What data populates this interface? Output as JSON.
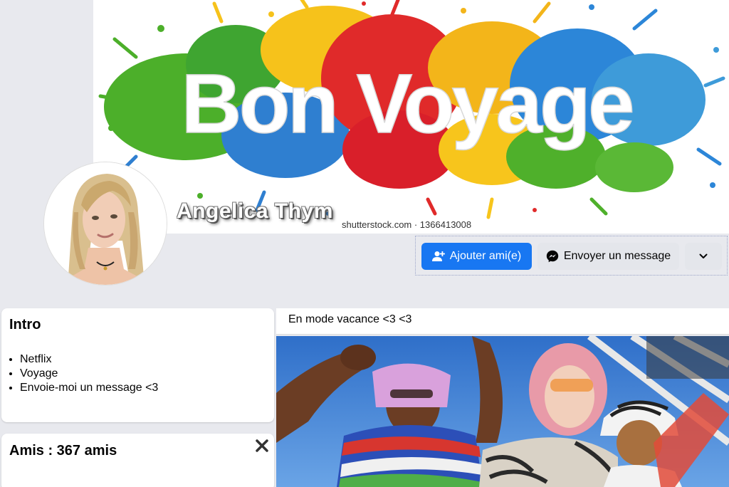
{
  "profile": {
    "name": "Angelica Thym",
    "cover_title": "Bon Voyage",
    "cover_watermark": "shutterstock.com · 1366413008"
  },
  "actions": {
    "add_friend_label": "Ajouter ami(e)",
    "message_label": "Envoyer un message"
  },
  "intro": {
    "title": "Intro",
    "items": [
      "Netflix",
      "Voyage",
      "Envoie-moi un message <3"
    ]
  },
  "friends": {
    "title": "Amis : 367 amis"
  },
  "post": {
    "text": "En mode vacance <3 <3"
  },
  "colors": {
    "accent": "#1877f2",
    "page_bg": "#e8e9ee",
    "secondary_button": "#e4e6eb"
  },
  "icons": {
    "add_friend": "person-plus-icon",
    "message": "messenger-icon",
    "more": "chevron-down-icon",
    "close": "close-icon"
  }
}
